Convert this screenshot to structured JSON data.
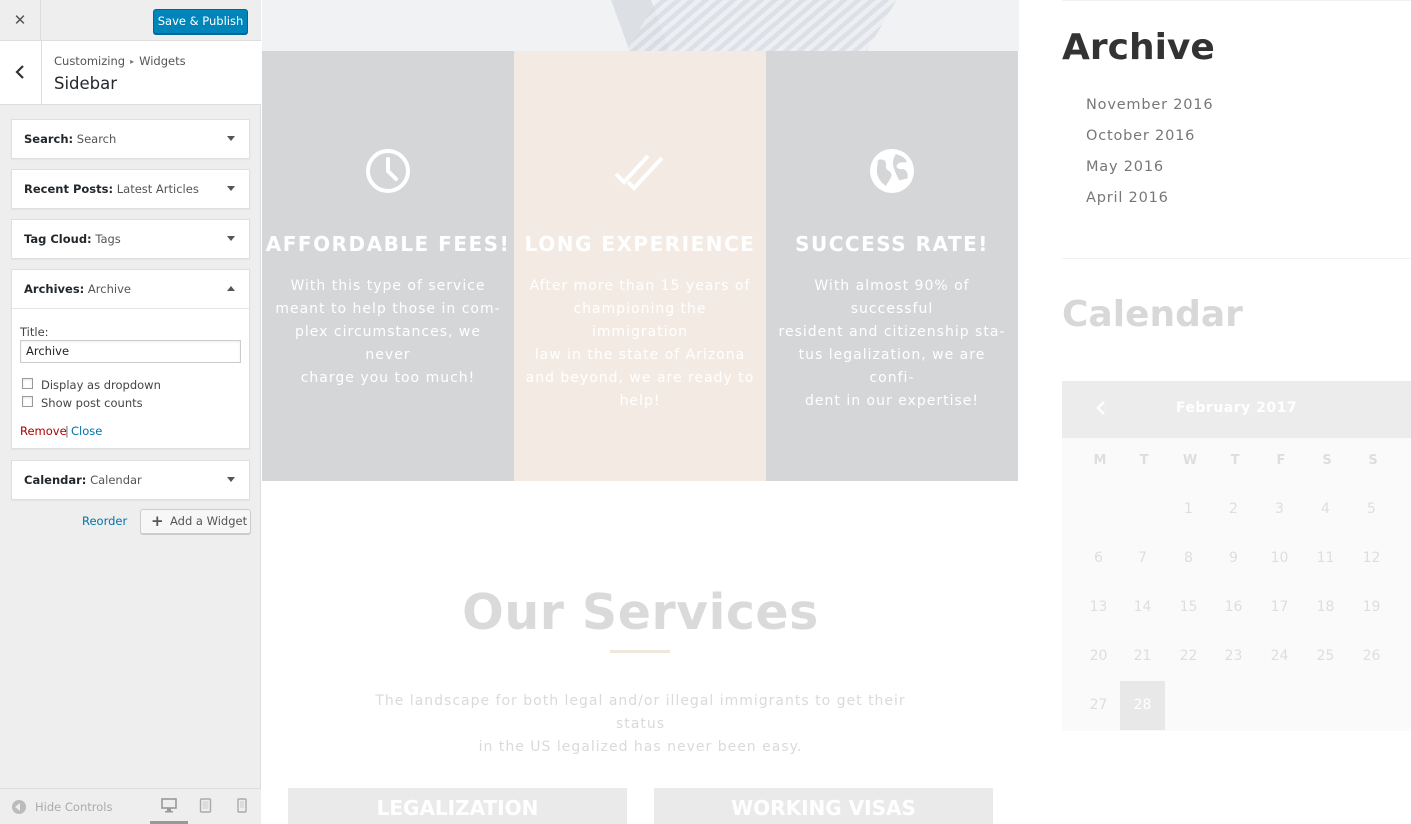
{
  "customizer": {
    "close_icon": "✕",
    "save_label": "Save & Publish",
    "breadcrumb": [
      "Customizing",
      "Widgets"
    ],
    "breadcrumb_separator": "▸",
    "section_title": "Sidebar",
    "widgets": [
      {
        "type": "Search:",
        "title": "Search",
        "expanded": false
      },
      {
        "type": "Recent Posts:",
        "title": "Latest Articles",
        "expanded": false
      },
      {
        "type": "Tag Cloud:",
        "title": "Tags",
        "expanded": false
      },
      {
        "type": "Archives:",
        "title": "Archive",
        "expanded": true
      },
      {
        "type": "Calendar:",
        "title": "Calendar",
        "expanded": false
      }
    ],
    "archives_form": {
      "title_label": "Title:",
      "title_value": "Archive",
      "dropdown_label": "Display as dropdown",
      "dropdown_checked": false,
      "counts_label": "Show post counts",
      "counts_checked": false,
      "remove_label": "Remove",
      "separator": "|",
      "close_label": "Close"
    },
    "reorder_label": "Reorder",
    "add_widget_label": "Add a Widget",
    "hide_controls_label": "Hide Controls",
    "devices": [
      "desktop-icon",
      "tablet-icon",
      "mobile-icon"
    ]
  },
  "preview": {
    "features": [
      {
        "icon": "clock-icon",
        "title": "AFFORDABLE FEES!",
        "lines": [
          "With this type of service",
          "meant to help those in com-",
          "plex circumstances, we never",
          "charge you too much!"
        ],
        "bg": "#d5d6d8"
      },
      {
        "icon": "double-check-icon",
        "title": "LONG EXPERIENCE",
        "lines": [
          "After more than 15 years of",
          "championing the immigration",
          "law in the state of Arizona",
          "and beyond, we are ready to",
          "help!"
        ],
        "bg": "#f3ebe3"
      },
      {
        "icon": "globe-icon",
        "title": "SUCCESS RATE!",
        "lines": [
          "With almost 90% of successful",
          "resident and citizenship sta-",
          "tus legalization, we are confi-",
          "dent in our expertise!"
        ],
        "bg": "#d5d6d8"
      }
    ],
    "services_title": "Our Services",
    "services_lines": [
      "The landscape for both legal and/or illegal immigrants to get their status",
      "in the US legalized has never been easy."
    ],
    "cards": [
      "LEGALIZATION",
      "WORKING VISAS"
    ]
  },
  "sidebar": {
    "archive_title": "Archive",
    "archive_items": [
      "November 2016",
      "October 2016",
      "May 2016",
      "April 2016"
    ],
    "calendar_title": "Calendar",
    "calendar": {
      "month": "February 2017",
      "weekdays": [
        "M",
        "T",
        "W",
        "T",
        "F",
        "S",
        "S"
      ],
      "first_weekday_index": 2,
      "days_in_month": 28,
      "today": 28
    }
  }
}
